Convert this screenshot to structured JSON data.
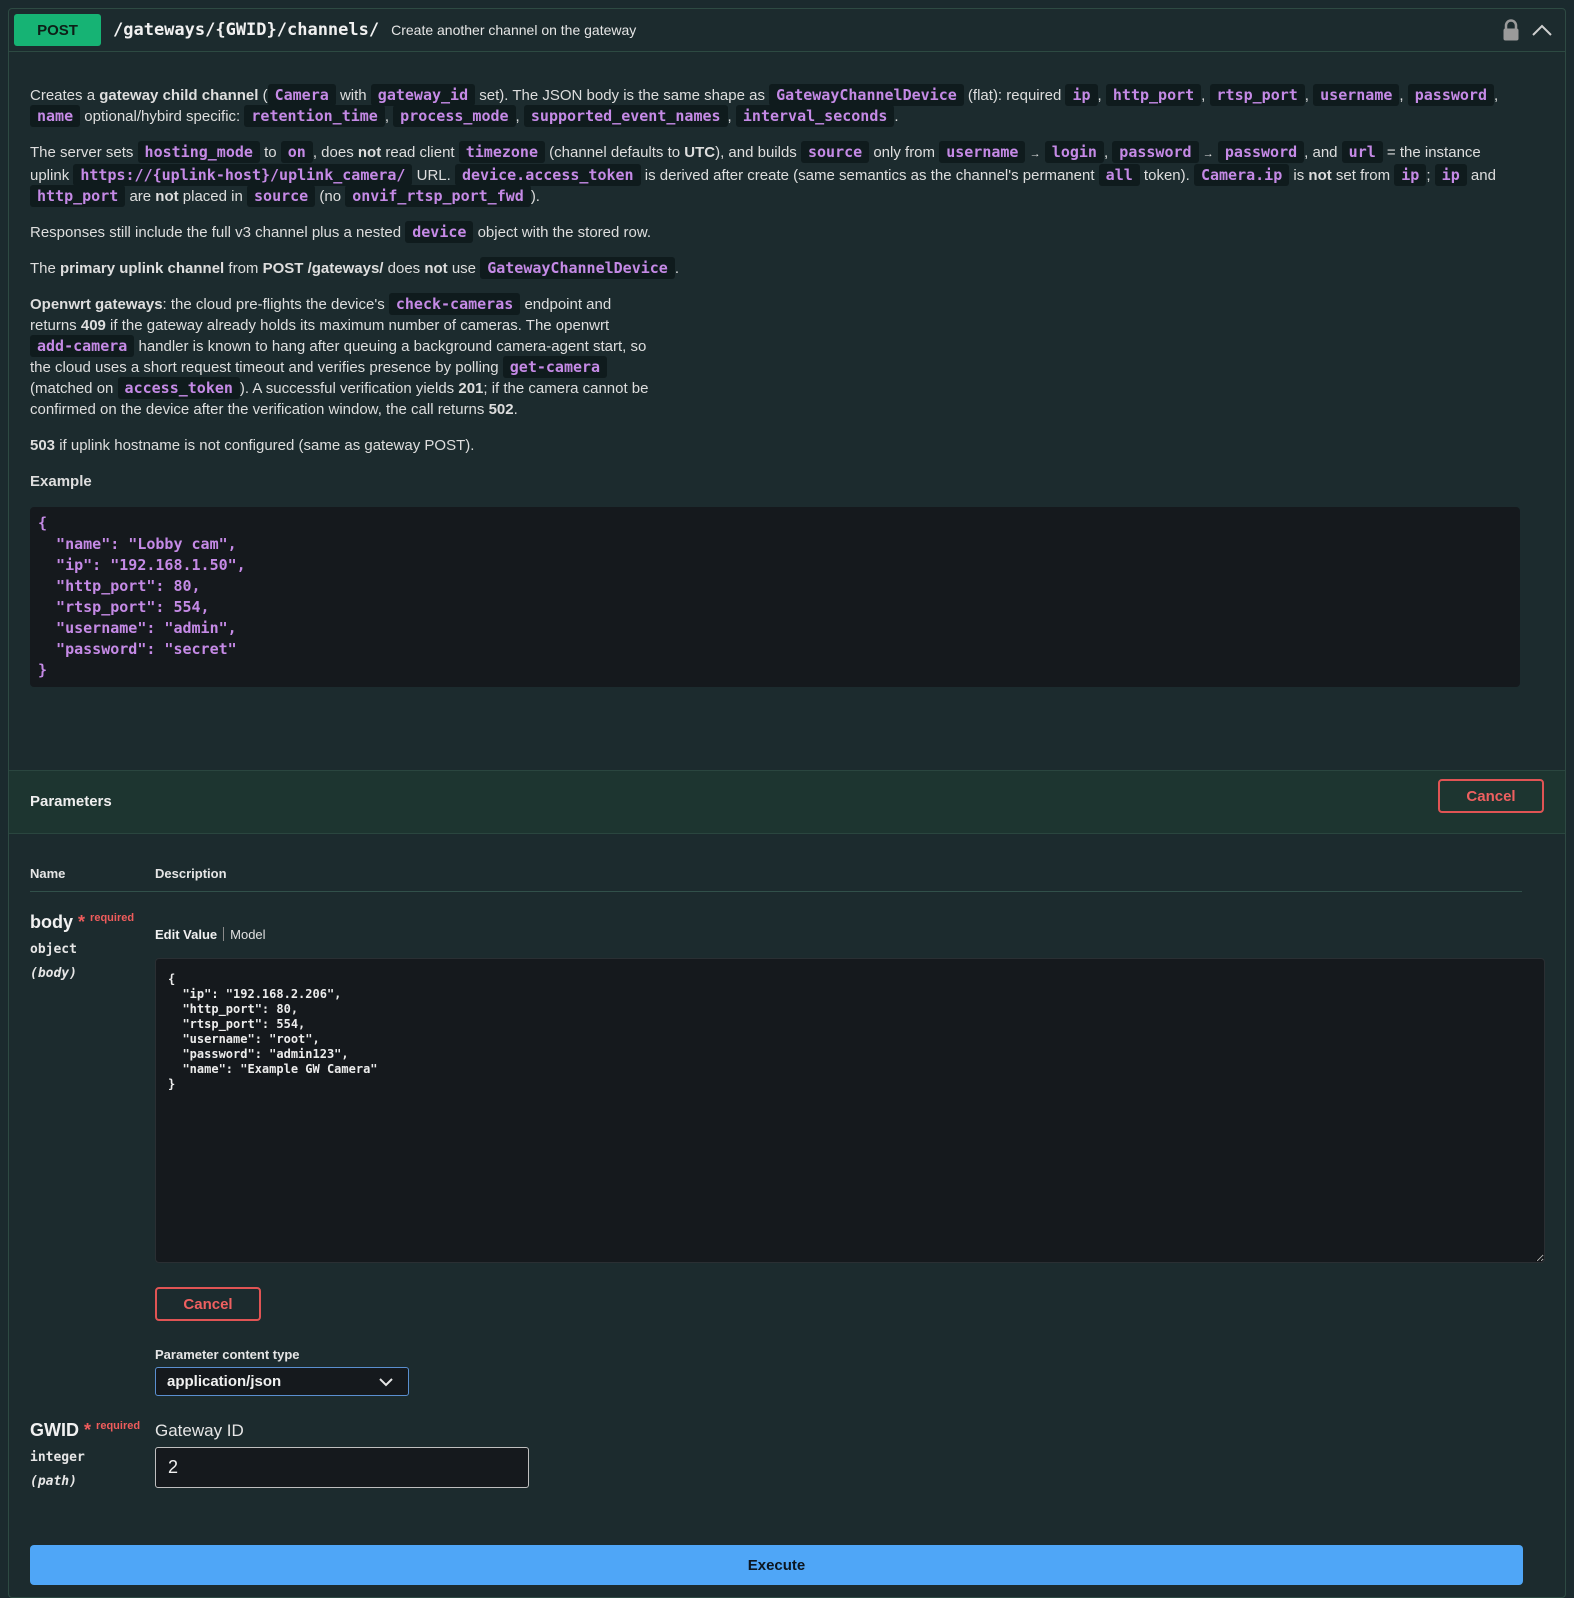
{
  "operation": {
    "method": "POST",
    "path": "/gateways/{GWID}/channels/",
    "summary": "Create another channel on the gateway"
  },
  "description": {
    "p1": {
      "t1": "Creates a ",
      "b1": "gateway child channel",
      "t2": " (",
      "c1": "Camera",
      "t3": " with ",
      "c2": "gateway_id",
      "t4": " set). The JSON body is the same shape as ",
      "c3": "GatewayChannelDevice",
      "t5": " (flat): required ",
      "c4": "ip",
      "t6": ", ",
      "c5": "http_port",
      "t7": ", ",
      "c6": "rtsp_port",
      "t8": ", ",
      "c7": "username",
      "t9": ", ",
      "c8": "password",
      "t10": ", ",
      "c9": "name",
      "t11": " optional/hybird specific: ",
      "c10": "retention_time",
      "t12": ", ",
      "c11": "process_mode",
      "t13": ", ",
      "c12": "supported_event_names",
      "t14": ", ",
      "c13": "interval_seconds",
      "t15": "."
    },
    "p2": {
      "t1": "The server sets ",
      "c1": "hosting_mode",
      "t2": " to ",
      "c2": "on",
      "t3": ", does ",
      "b1": "not",
      "t4": " read client ",
      "c3": "timezone",
      "t5": " (channel defaults to ",
      "b2": "UTC",
      "t6": "), and builds ",
      "c4": "source",
      "t7": " only from ",
      "c5": "username",
      "a1": "→",
      "c6": "login",
      "t8": ", ",
      "c7": "password",
      "a2": "→",
      "c8": "password",
      "t9": ", and ",
      "c9": "url",
      "t10": " = the instance uplink ",
      "c10": "https://{uplink-host}/uplink_camera/",
      "t11": " URL. ",
      "c11": "device.access_token",
      "t12": " is derived after create (same semantics as the channel's permanent ",
      "c12": "all",
      "t13": " token). ",
      "c13": "Camera.ip",
      "t14": " is ",
      "b3": "not",
      "t15": " set from ",
      "c14": "ip",
      "t16": "; ",
      "c15": "ip",
      "t17": " and ",
      "c16": "http_port",
      "t18": " are ",
      "b4": "not",
      "t19": " placed in ",
      "c17": "source",
      "t20": " (no ",
      "c18": "onvif_rtsp_port_fwd",
      "t21": ")."
    },
    "p3": {
      "t1": "Responses still include the full v3 channel plus a nested ",
      "c1": "device",
      "t2": " object with the stored row."
    },
    "p4": {
      "t1": "The ",
      "b1": "primary uplink channel",
      "t2": " from ",
      "b2": "POST /gateways/",
      "t3": " does ",
      "b3": "not",
      "t4": " use ",
      "c1": "GatewayChannelDevice",
      "t5": "."
    },
    "p5": {
      "b1": "Openwrt gateways",
      "t1": ": the cloud pre-flights the device's ",
      "c1": "check-cameras",
      "t2": " endpoint and returns ",
      "b2": "409",
      "t3": " if the gateway already holds its maximum number of cameras. The openwrt ",
      "c2": "add-camera",
      "t4": " handler is known to hang after queuing a background camera-agent start, so the cloud uses a short request timeout and verifies presence by polling ",
      "c3": "get-camera",
      "t5": " (matched on ",
      "c4": "access_token",
      "t6": "). A successful verification yields ",
      "b3": "201",
      "t7": "; if the camera cannot be confirmed on the device after the verification window, the call returns ",
      "b4": "502",
      "t8": "."
    },
    "p6": {
      "b1": "503",
      "t1": " if uplink hostname is not configured (same as gateway POST)."
    },
    "example_label": "Example",
    "example_code": "{\n  \"name\": \"Lobby cam\",\n  \"ip\": \"192.168.1.50\",\n  \"http_port\": 80,\n  \"rtsp_port\": 554,\n  \"username\": \"admin\",\n  \"password\": \"secret\"\n}"
  },
  "parameters": {
    "title": "Parameters",
    "cancel_label": "Cancel",
    "col_name": "Name",
    "col_description": "Description",
    "body": {
      "name": "body",
      "star": "*",
      "required": "required",
      "type": "object",
      "location": "(body)",
      "tab_edit": "Edit Value",
      "tab_model": "Model",
      "value": "{\n  \"ip\": \"192.168.2.206\",\n  \"http_port\": 80,\n  \"rtsp_port\": 554,\n  \"username\": \"root\",\n  \"password\": \"admin123\",\n  \"name\": \"Example GW Camera\"\n}",
      "cancel_label": "Cancel",
      "content_type_label": "Parameter content type",
      "content_type_value": "application/json"
    },
    "gwid": {
      "name": "GWID",
      "star": "*",
      "required": "required",
      "type": "integer",
      "location": "(path)",
      "description": "Gateway ID",
      "value": "2"
    }
  },
  "execute_label": "Execute",
  "colors": {
    "post_green": "#16b374",
    "code_purple": "#c58ae6",
    "cancel_red": "#e05454",
    "execute_blue": "#4fa6f7",
    "background": "#1c2b2e"
  },
  "icons": [
    "lock-icon",
    "chevron-up-icon",
    "chevron-down-icon"
  ]
}
